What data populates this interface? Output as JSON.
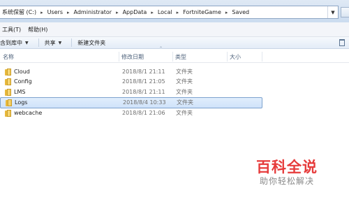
{
  "address_bar": {
    "crumbs": [
      "系统保留 (C:)",
      "Users",
      "Administrator",
      "AppData",
      "Local",
      "FortniteGame",
      "Saved"
    ]
  },
  "menu": {
    "items": [
      "工具(T)",
      "帮助(H)"
    ]
  },
  "toolbar": {
    "include_library": "含到库中",
    "share": "共享",
    "new_folder": "新建文件夹"
  },
  "columns": {
    "name": "名称",
    "date_modified": "修改日期",
    "type": "类型",
    "size": "大小"
  },
  "files": [
    {
      "name": "Cloud",
      "date": "2018/8/1 21:11",
      "type": "文件夹",
      "selected": false
    },
    {
      "name": "Config",
      "date": "2018/8/1 21:05",
      "type": "文件夹",
      "selected": false
    },
    {
      "name": "LMS",
      "date": "2018/8/1 21:11",
      "type": "文件夹",
      "selected": false
    },
    {
      "name": "Logs",
      "date": "2018/8/4 10:33",
      "type": "文件夹",
      "selected": true
    },
    {
      "name": "webcache",
      "date": "2018/8/1 21:06",
      "type": "文件夹",
      "selected": false
    }
  ],
  "watermark": {
    "logo_text": "百科全说",
    "subtitle": "助你轻松解决"
  },
  "colors": {
    "selection_border": "#7da2ce",
    "folder": "#e8b93c",
    "watermark_red": "#e63b3b"
  }
}
